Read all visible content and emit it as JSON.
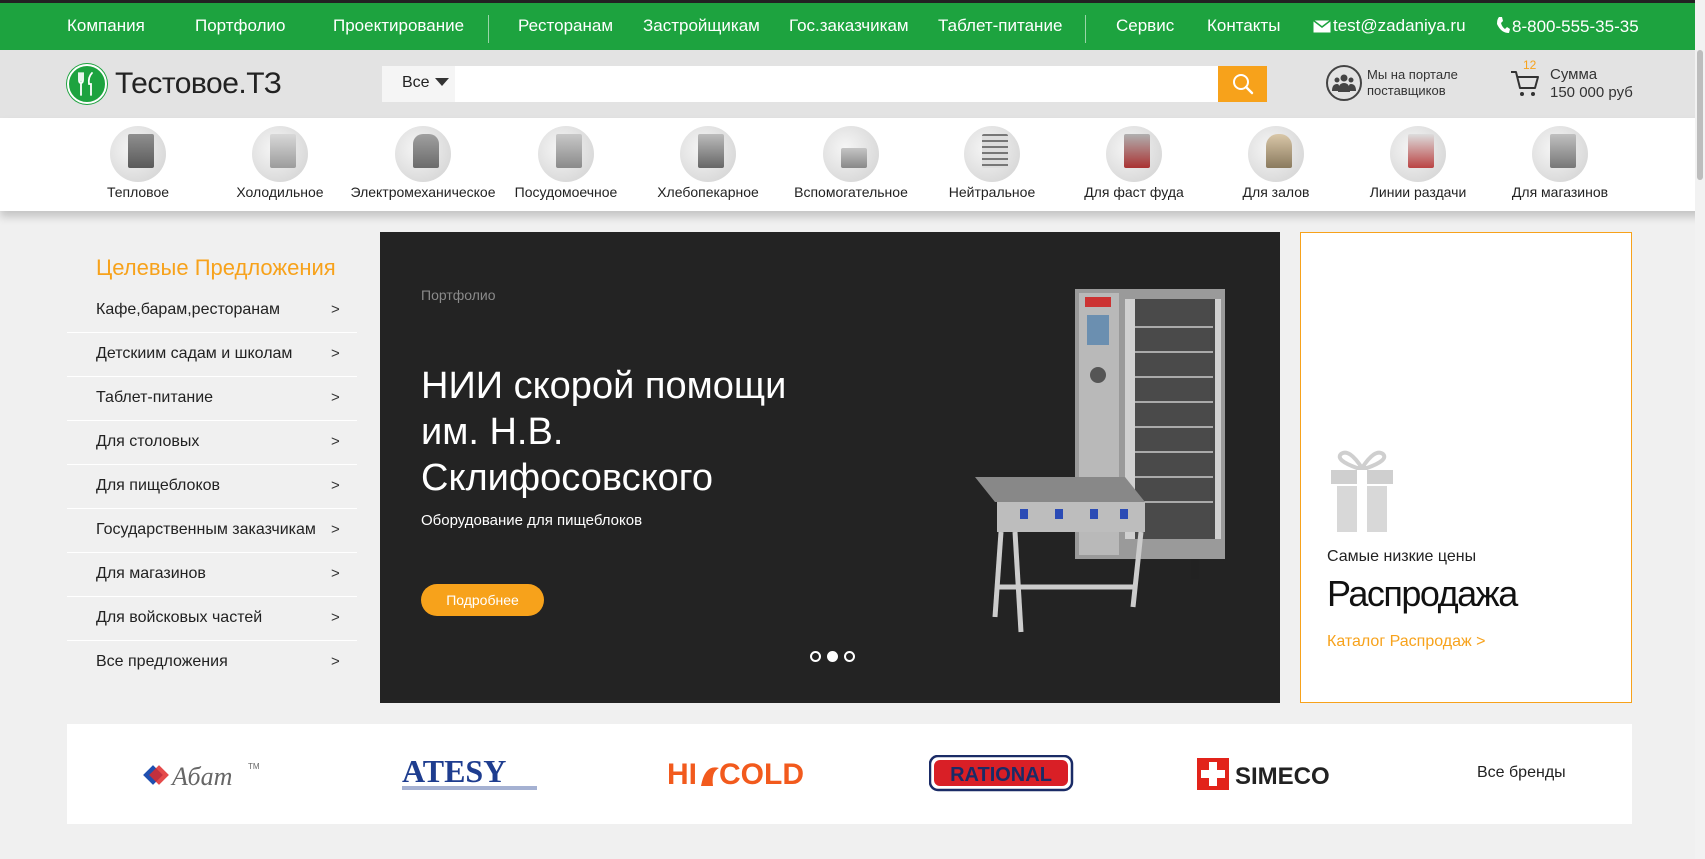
{
  "topnav": {
    "items": [
      "Компания",
      "Портфолио",
      "Проектирование",
      "Ресторанам",
      "Застройщикам",
      "Гос.заказчикам",
      "Таблет-питание",
      "Сервис",
      "Контакты"
    ],
    "email": "test@zadaniya.ru",
    "phone": "8-800-555-35-35"
  },
  "header": {
    "logo": "Тестовое.ТЗ",
    "search_category": "Все",
    "search_placeholder": "",
    "portal_line1": "Мы на портале",
    "portal_line2": "поставщиков",
    "cart_count": "12",
    "cart_label": "Сумма",
    "cart_sum": "150 000 руб"
  },
  "categories": [
    "Тепловое",
    "Холодильное",
    "Электромеханическое",
    "Посудомоечное",
    "Хлебопекарное",
    "Вспомогательное",
    "Нейтральное",
    "Для фаст фуда",
    "Для залов",
    "Линии раздачи",
    "Для магазинов"
  ],
  "sidebar": {
    "title": "Целевые Предложения",
    "items": [
      "Кафе,барам,ресторанам",
      "Детскиим садам и школам",
      "Таблет-питание",
      "Для столовых",
      "Для пищеблоков",
      "Государственным заказчикам",
      "Для магазинов",
      "Для войсковых частей",
      "Все предложения"
    ],
    "arrow": ">"
  },
  "slider": {
    "kicker": "Портфолио",
    "title": "НИИ скорой помощи им. Н.В. Склифосовского",
    "subtitle": "Оборудование для пищеблоков",
    "button": "Подробнее",
    "active_slide": 2,
    "total_slides": 3
  },
  "sale": {
    "line1": "Самые низкие цены",
    "headline": "Распродажа",
    "link": "Каталог Распродаж  >"
  },
  "brands": {
    "items": [
      "Абат",
      "ATESY",
      "HICOLD",
      "RATIONAL",
      "SIMECO"
    ],
    "all_label": "Все бренды"
  },
  "colors": {
    "green": "#1da33f",
    "orange": "#f7a21b",
    "dark": "#232323"
  }
}
